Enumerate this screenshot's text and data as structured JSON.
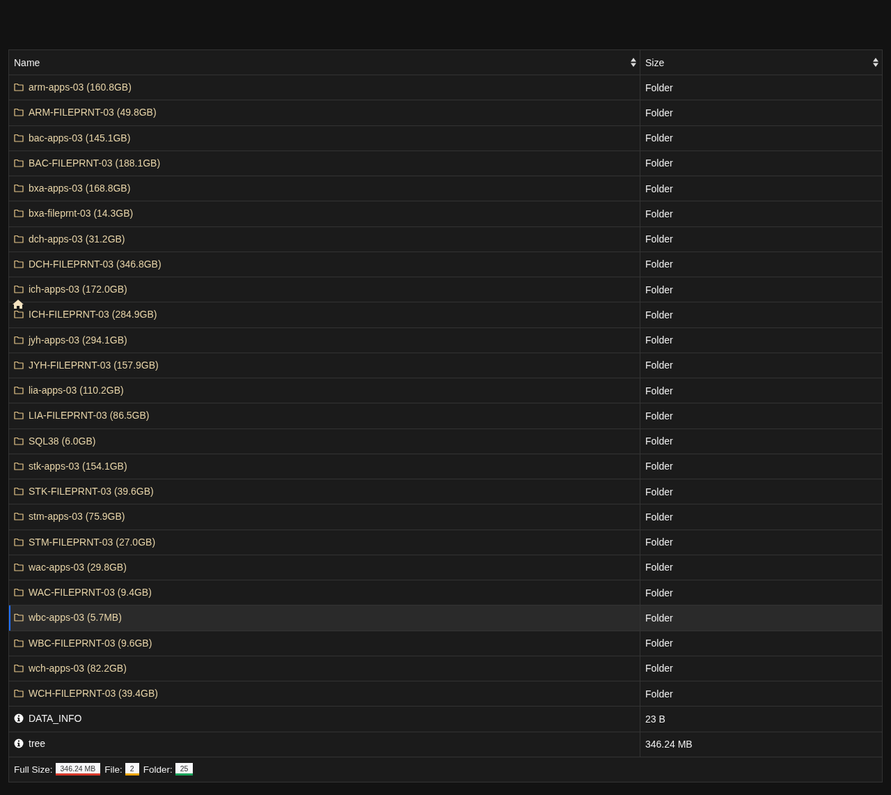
{
  "table": {
    "columns": [
      {
        "label": "Name"
      },
      {
        "label": "Size"
      }
    ],
    "rows": [
      {
        "kind": "folder",
        "name": "arm-apps-03 (160.8GB)",
        "size": "Folder",
        "selected": false
      },
      {
        "kind": "folder",
        "name": "ARM-FILEPRNT-03 (49.8GB)",
        "size": "Folder",
        "selected": false
      },
      {
        "kind": "folder",
        "name": "bac-apps-03 (145.1GB)",
        "size": "Folder",
        "selected": false
      },
      {
        "kind": "folder",
        "name": "BAC-FILEPRNT-03 (188.1GB)",
        "size": "Folder",
        "selected": false
      },
      {
        "kind": "folder",
        "name": "bxa-apps-03 (168.8GB)",
        "size": "Folder",
        "selected": false
      },
      {
        "kind": "folder",
        "name": "bxa-fileprnt-03 (14.3GB)",
        "size": "Folder",
        "selected": false
      },
      {
        "kind": "folder",
        "name": "dch-apps-03 (31.2GB)",
        "size": "Folder",
        "selected": false
      },
      {
        "kind": "folder",
        "name": "DCH-FILEPRNT-03 (346.8GB)",
        "size": "Folder",
        "selected": false
      },
      {
        "kind": "folder",
        "name": "ich-apps-03 (172.0GB)",
        "size": "Folder",
        "selected": false
      },
      {
        "kind": "folder",
        "name": "ICH-FILEPRNT-03 (284.9GB)",
        "size": "Folder",
        "selected": false
      },
      {
        "kind": "folder",
        "name": "jyh-apps-03 (294.1GB)",
        "size": "Folder",
        "selected": false
      },
      {
        "kind": "folder",
        "name": "JYH-FILEPRNT-03 (157.9GB)",
        "size": "Folder",
        "selected": false
      },
      {
        "kind": "folder",
        "name": "lia-apps-03 (110.2GB)",
        "size": "Folder",
        "selected": false
      },
      {
        "kind": "folder",
        "name": "LIA-FILEPRNT-03 (86.5GB)",
        "size": "Folder",
        "selected": false
      },
      {
        "kind": "folder",
        "name": "SQL38 (6.0GB)",
        "size": "Folder",
        "selected": false
      },
      {
        "kind": "folder",
        "name": "stk-apps-03 (154.1GB)",
        "size": "Folder",
        "selected": false
      },
      {
        "kind": "folder",
        "name": "STK-FILEPRNT-03 (39.6GB)",
        "size": "Folder",
        "selected": false
      },
      {
        "kind": "folder",
        "name": "stm-apps-03 (75.9GB)",
        "size": "Folder",
        "selected": false
      },
      {
        "kind": "folder",
        "name": "STM-FILEPRNT-03 (27.0GB)",
        "size": "Folder",
        "selected": false
      },
      {
        "kind": "folder",
        "name": "wac-apps-03 (29.8GB)",
        "size": "Folder",
        "selected": false
      },
      {
        "kind": "folder",
        "name": "WAC-FILEPRNT-03 (9.4GB)",
        "size": "Folder",
        "selected": false
      },
      {
        "kind": "folder",
        "name": "wbc-apps-03 (5.7MB)",
        "size": "Folder",
        "selected": true
      },
      {
        "kind": "folder",
        "name": "WBC-FILEPRNT-03 (9.6GB)",
        "size": "Folder",
        "selected": false
      },
      {
        "kind": "folder",
        "name": "wch-apps-03 (82.2GB)",
        "size": "Folder",
        "selected": false
      },
      {
        "kind": "folder",
        "name": "WCH-FILEPRNT-03 (39.4GB)",
        "size": "Folder",
        "selected": false
      },
      {
        "kind": "file",
        "name": "DATA_INFO",
        "size": "23 B",
        "selected": false
      },
      {
        "kind": "file",
        "name": "tree",
        "size": "346.24 MB",
        "selected": false
      }
    ],
    "footer": [
      {
        "label": "Full Size:",
        "value": "346.24 MB",
        "color": "#d93a2b"
      },
      {
        "label": "File:",
        "value": "2",
        "color": "#f0a500"
      },
      {
        "label": "Folder:",
        "value": "25",
        "color": "#1aa35a"
      }
    ]
  }
}
